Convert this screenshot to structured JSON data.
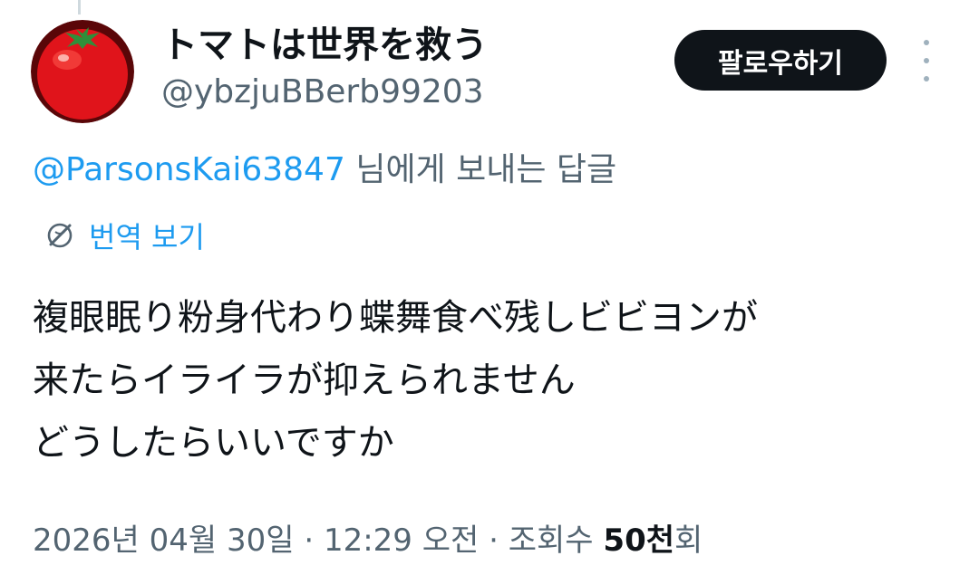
{
  "author": {
    "display_name": "トマトは世界を救う",
    "handle": "@ybzjuBBerb99203",
    "avatar_icon": "tomato-icon"
  },
  "follow_button": {
    "label": "팔로우하기"
  },
  "more_menu": {
    "icon": "more-vertical-icon"
  },
  "reply_context": {
    "mention": "@ParsonsKai63847",
    "suffix": " 님에게 보내는 답글"
  },
  "translate": {
    "icon": "globe-slash-icon",
    "label": "번역 보기"
  },
  "tweet": {
    "lines": [
      "複眼眠り粉身代わり蝶舞食べ残しビビヨンが",
      "来たらイライラが抑えられません",
      "どうしたらいいですか"
    ]
  },
  "meta": {
    "date": "2026년 04월 30일",
    "separator1": " · ",
    "time": "12:29 오전",
    "separator2": " · ",
    "views_label": "조회수 ",
    "views_value": "50천",
    "views_suffix": "회"
  },
  "colors": {
    "link": "#1d9bf0",
    "secondary_text": "#536471",
    "primary_text": "#0f1419",
    "button_bg": "#0f1419",
    "tomato_red": "#e0141b",
    "tomato_leaf": "#2f8f3a"
  }
}
